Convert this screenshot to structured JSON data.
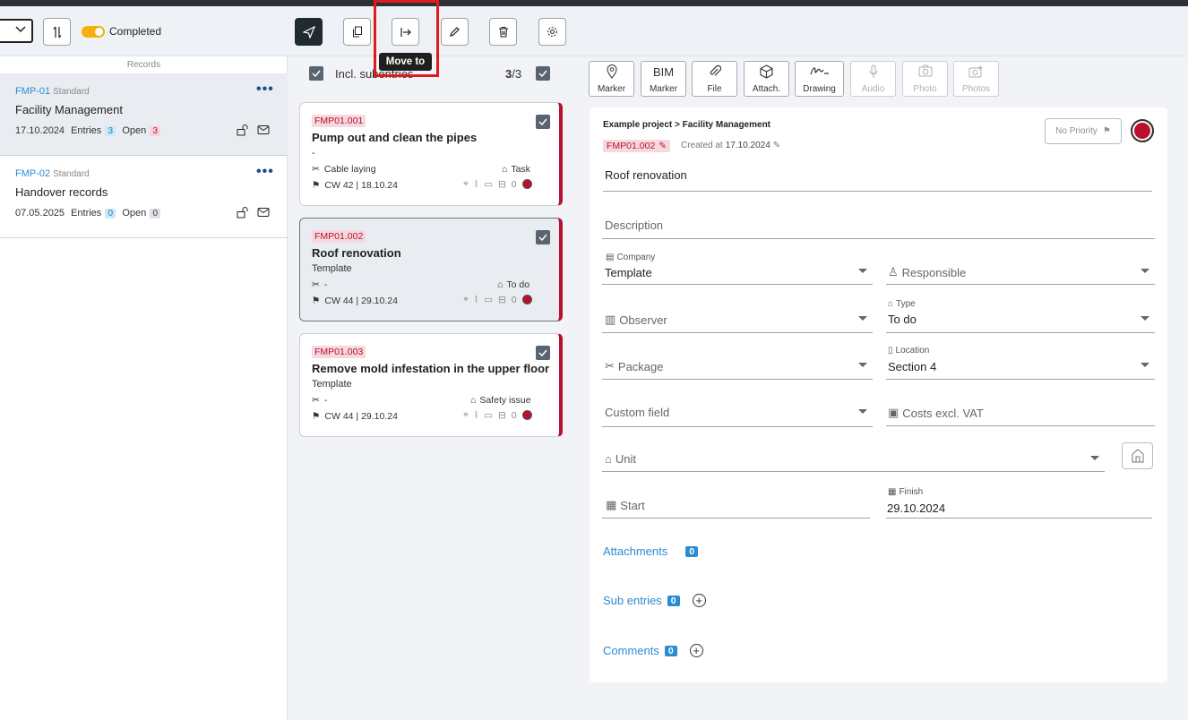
{
  "toolbar": {
    "completed_label": "Completed",
    "tooltip": "Move to"
  },
  "records": {
    "header": "Records",
    "items": [
      {
        "code": "FMP-01",
        "kind": "Standard",
        "title": "Facility Management",
        "date": "17.10.2024",
        "entries_label": "Entries",
        "entries": "3",
        "open_label": "Open",
        "open": "3"
      },
      {
        "code": "FMP-02",
        "kind": "Standard",
        "title": "Handover records",
        "date": "07.05.2025",
        "entries_label": "Entries",
        "entries": "0",
        "open_label": "Open",
        "open": "0"
      }
    ]
  },
  "entries": {
    "include_label": "Incl. subentries",
    "count_selected": "3",
    "count_total": "/3",
    "cards": [
      {
        "code": "FMP01.001",
        "title": "Pump out and clean the pipes",
        "sub": "-",
        "package": "Cable laying",
        "tag": "Task",
        "cw": "CW 42 | 18.10.24",
        "comments": "0"
      },
      {
        "code": "FMP01.002",
        "title": "Roof renovation",
        "sub": "Template",
        "package": "-",
        "tag": "To do",
        "cw": "CW 44 | 29.10.24",
        "comments": "0"
      },
      {
        "code": "FMP01.003",
        "title": "Remove mold infestation in the upper floor",
        "sub": "Template",
        "package": "-",
        "tag": "Safety issue",
        "cw": "CW 44 | 29.10.24",
        "comments": "0"
      }
    ]
  },
  "media": {
    "marker": "Marker",
    "bim_top": "BIM",
    "bim_bottom": "Marker",
    "file": "File",
    "attach": "Attach.",
    "drawing": "Drawing",
    "audio": "Audio",
    "photo": "Photo",
    "photos": "Photos"
  },
  "detail": {
    "breadcrumb": "Example project > Facility Management",
    "id": "FMP01.002",
    "created_label": "Created at",
    "created_date": "17.10.2024",
    "priority": "No Priority",
    "title": "Roof renovation",
    "description_ph": "Description",
    "company_label": "Company",
    "company": "Template",
    "responsible_ph": "Responsible",
    "observer_ph": "Observer",
    "type_label": "Type",
    "type": "To do",
    "package_ph": "Package",
    "location_label": "Location",
    "location": "Section 4",
    "custom_ph": "Custom field",
    "costs_ph": "Costs excl. VAT",
    "unit_ph": "Unit",
    "start_ph": "Start",
    "finish_label": "Finish",
    "finish": "29.10.2024",
    "attachments_label": "Attachments",
    "attachments_count": "0",
    "subentries_label": "Sub entries",
    "subentries_count": "0",
    "comments_label": "Comments",
    "comments_count": "0"
  }
}
